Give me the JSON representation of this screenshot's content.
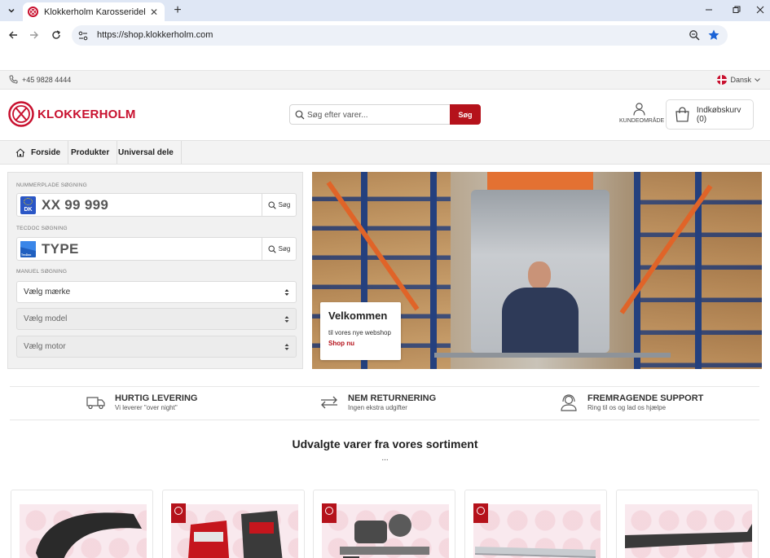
{
  "browser": {
    "tab_title": "Klokkerholm Karosseridele - Fe",
    "url": "https://shop.klokkerholm.com"
  },
  "topbar": {
    "phone": "+45 9828 4444",
    "language": "Dansk"
  },
  "header": {
    "logo_text": "KLOKKERHOLM",
    "search_placeholder": "Søg efter varer...",
    "search_button": "Søg",
    "account_label": "KUNDEOMRÅDE",
    "cart_label": "Indkøbskurv (0)"
  },
  "nav": {
    "items": [
      {
        "label": "Forside"
      },
      {
        "label": "Produkter"
      },
      {
        "label": "Universal dele"
      }
    ]
  },
  "search_panel": {
    "plate_label": "NUMMERPLADE SØGNING",
    "plate_placeholder": "XX 99 999",
    "plate_country": "DK",
    "plate_button": "Søg",
    "tecdoc_label": "TECDOC SØGNING",
    "tecdoc_placeholder": "TYPE",
    "tecdoc_button": "Søg",
    "manual_label": "MANUEL SØGNING",
    "selects": [
      {
        "label": "Vælg mærke",
        "enabled": true
      },
      {
        "label": "Vælg model",
        "enabled": false
      },
      {
        "label": "Vælg motor",
        "enabled": false
      }
    ]
  },
  "hero": {
    "title": "Velkommen",
    "subtitle": "til vores nye webshop",
    "link": "Shop nu"
  },
  "usps": [
    {
      "title": "HURTIG LEVERING",
      "subtitle": "Vi leverer \"over night\"",
      "icon": "truck-icon"
    },
    {
      "title": "NEM RETURNERING",
      "subtitle": "Ingen ekstra udgifter",
      "icon": "arrows-exchange-icon"
    },
    {
      "title": "FREMRAGENDE SUPPORT",
      "subtitle": "Ring til os og lad os hjælpe",
      "icon": "support-headset-icon"
    }
  ],
  "featured": {
    "title": "Udvalgte varer fra vores sortiment",
    "dots": "..."
  },
  "colors": {
    "brand_red": "#b5121b",
    "logo_red": "#c8102e"
  }
}
